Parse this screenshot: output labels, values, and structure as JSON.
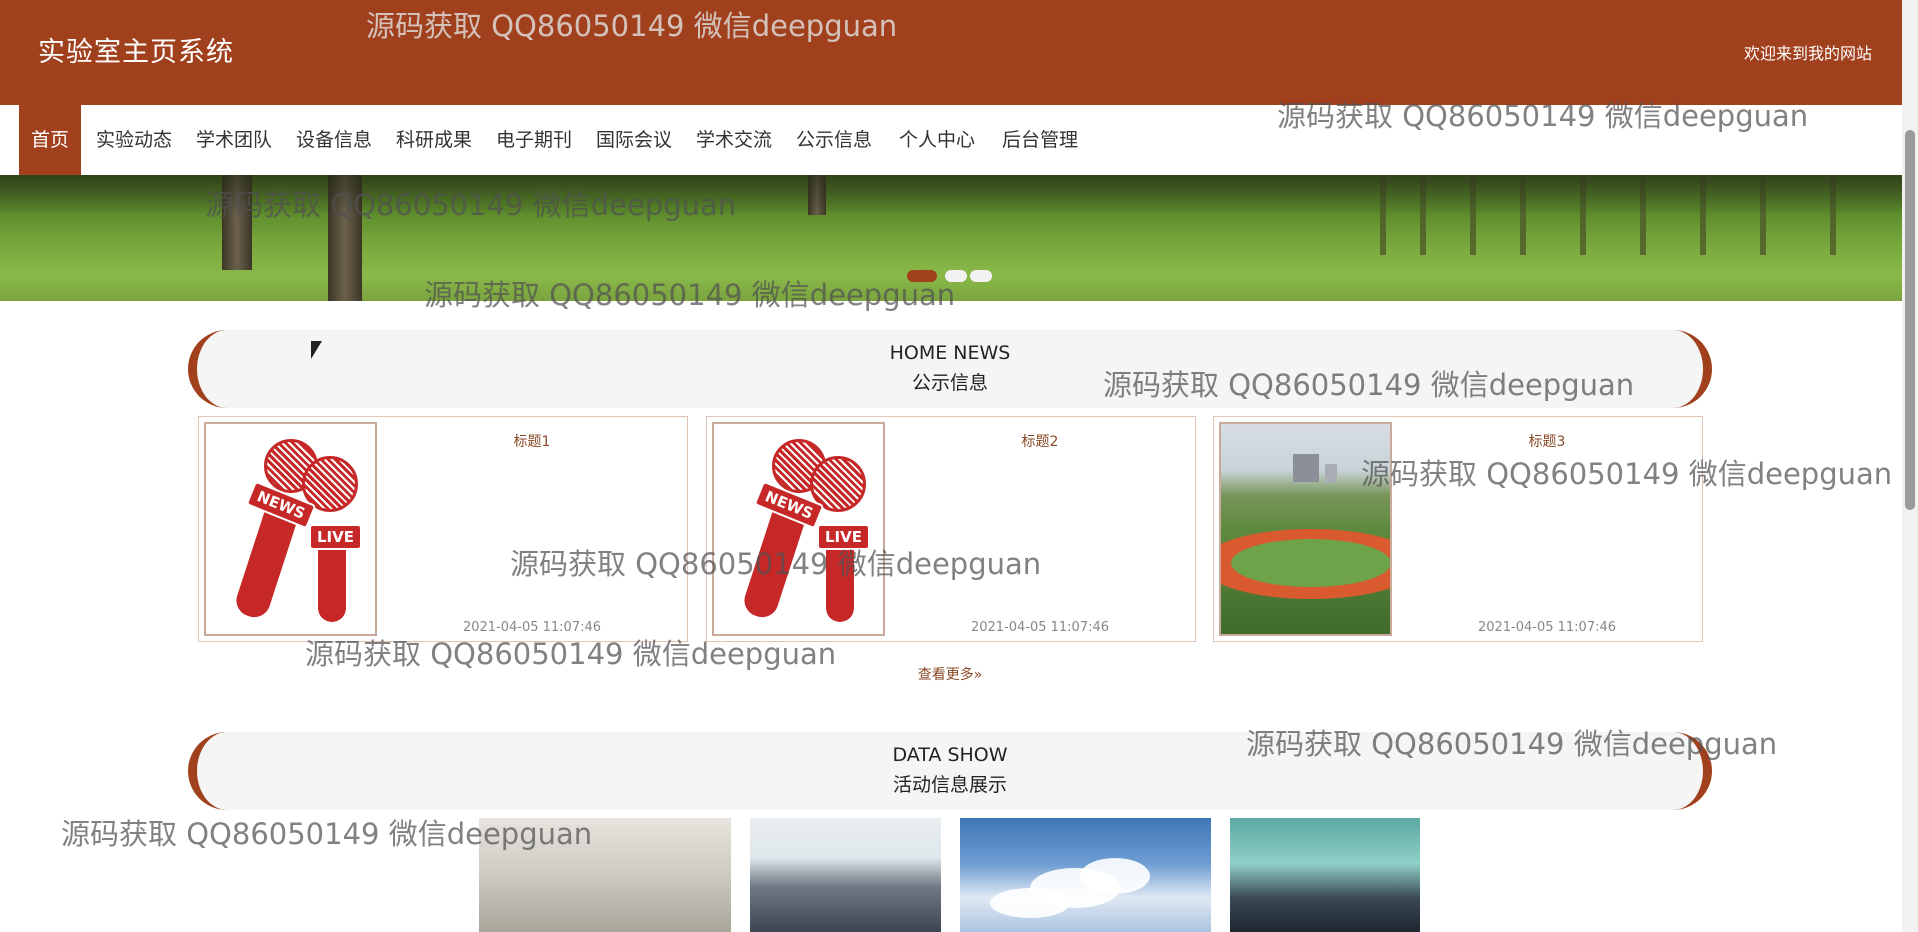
{
  "header": {
    "title": "实验室主页系统",
    "welcome": "欢迎来到我的网站"
  },
  "nav": {
    "items": [
      {
        "label": "首页",
        "active": true
      },
      {
        "label": "实验动态"
      },
      {
        "label": "学术团队"
      },
      {
        "label": "设备信息"
      },
      {
        "label": "科研成果"
      },
      {
        "label": "电子期刊"
      },
      {
        "label": "国际会议"
      },
      {
        "label": "学术交流"
      },
      {
        "label": "公示信息"
      },
      {
        "label": "个人中心"
      },
      {
        "label": "后台管理"
      }
    ]
  },
  "banner": {
    "slide_count": 3,
    "active_slide": 1
  },
  "news_section": {
    "title_en": "HOME NEWS",
    "title_cn": "公示信息",
    "cards": [
      {
        "title": "标题1",
        "date": "2021-04-05 11:07:46",
        "image": "news-live-microphone",
        "tag_news": "NEWS",
        "tag_live": "LIVE"
      },
      {
        "title": "标题2",
        "date": "2021-04-05 11:07:46",
        "image": "news-live-microphone",
        "tag_news": "NEWS",
        "tag_live": "LIVE"
      },
      {
        "title": "标题3",
        "date": "2021-04-05 11:07:46",
        "image": "campus-sports-field"
      }
    ],
    "more_label": "查看更多»"
  },
  "data_section": {
    "title_en": "DATA SHOW",
    "title_cn": "活动信息展示"
  },
  "watermark": {
    "text": "源码获取 QQ86050149 微信deepguan"
  },
  "colors": {
    "brand": "#a0401d",
    "link": "#8a4a26"
  }
}
